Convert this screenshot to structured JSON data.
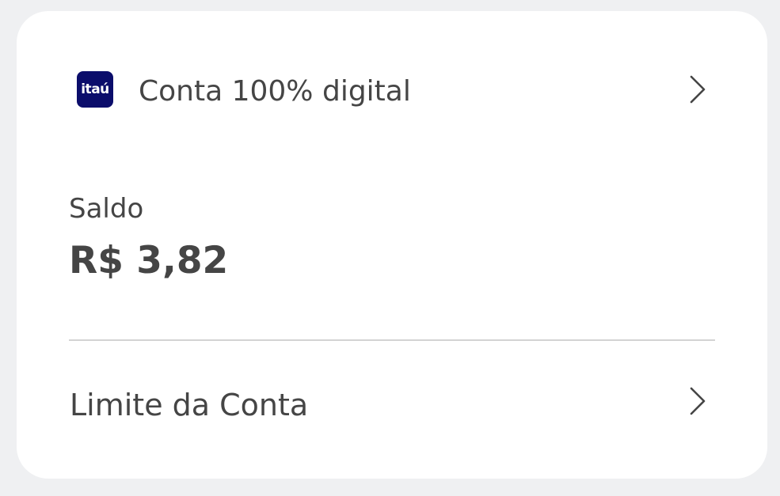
{
  "account": {
    "logo_text": "itaú",
    "title": "Conta 100% digital",
    "chevron_icon": "chevron-right-icon"
  },
  "balance": {
    "label": "Saldo",
    "value": "R$ 3,82"
  },
  "limit": {
    "label": "Limite da Conta",
    "chevron_icon": "chevron-right-icon"
  },
  "colors": {
    "background": "#eff0f2",
    "card": "#ffffff",
    "text": "#454545",
    "brand": "#0b0d6b",
    "divider": "#d3d3d3"
  }
}
